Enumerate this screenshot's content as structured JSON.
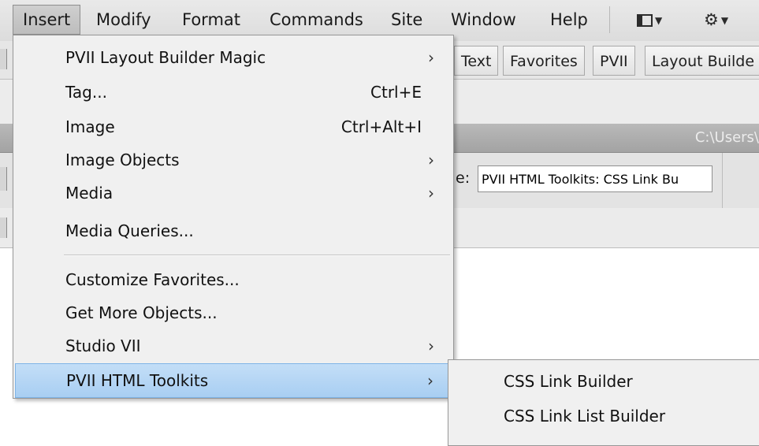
{
  "menubar": {
    "items": [
      "Insert",
      "Modify",
      "Format",
      "Commands",
      "Site",
      "Window",
      "Help"
    ],
    "layout_icon": "layout-icon",
    "settings_icon": "gear-icon"
  },
  "insert_bar": {
    "tabs": [
      "Text",
      "Favorites",
      "PVII",
      "Layout Builde"
    ]
  },
  "path_bar": {
    "text": "C:\\Users\\"
  },
  "doc_toolbar": {
    "title_label": "e:",
    "title_value": "PVII HTML Toolkits: CSS Link Bu"
  },
  "dropdown": {
    "items": [
      {
        "label": "PVII Layout Builder Magic",
        "shortcut": "",
        "arrow": "›"
      },
      {
        "label": "Tag...",
        "shortcut": "Ctrl+E",
        "arrow": ""
      },
      {
        "label": "Image",
        "shortcut": "Ctrl+Alt+I",
        "arrow": ""
      },
      {
        "label": "Image Objects",
        "shortcut": "",
        "arrow": "›"
      },
      {
        "label": "Media",
        "shortcut": "",
        "arrow": "›"
      },
      {
        "label": "Media Queries...",
        "shortcut": "",
        "arrow": ""
      },
      {
        "label": "Customize Favorites...",
        "shortcut": "",
        "arrow": ""
      },
      {
        "label": "Get More Objects...",
        "shortcut": "",
        "arrow": ""
      },
      {
        "label": "Studio VII",
        "shortcut": "",
        "arrow": "›"
      },
      {
        "label": "PVII HTML Toolkits",
        "shortcut": "",
        "arrow": "›"
      }
    ]
  },
  "submenu": {
    "items": [
      "CSS Link Builder",
      "CSS Link List Builder"
    ]
  },
  "colors": {
    "highlight": "#a8cef2",
    "menu_bg": "#f0f0f0",
    "menubar_bg": "#dcdcdc"
  }
}
